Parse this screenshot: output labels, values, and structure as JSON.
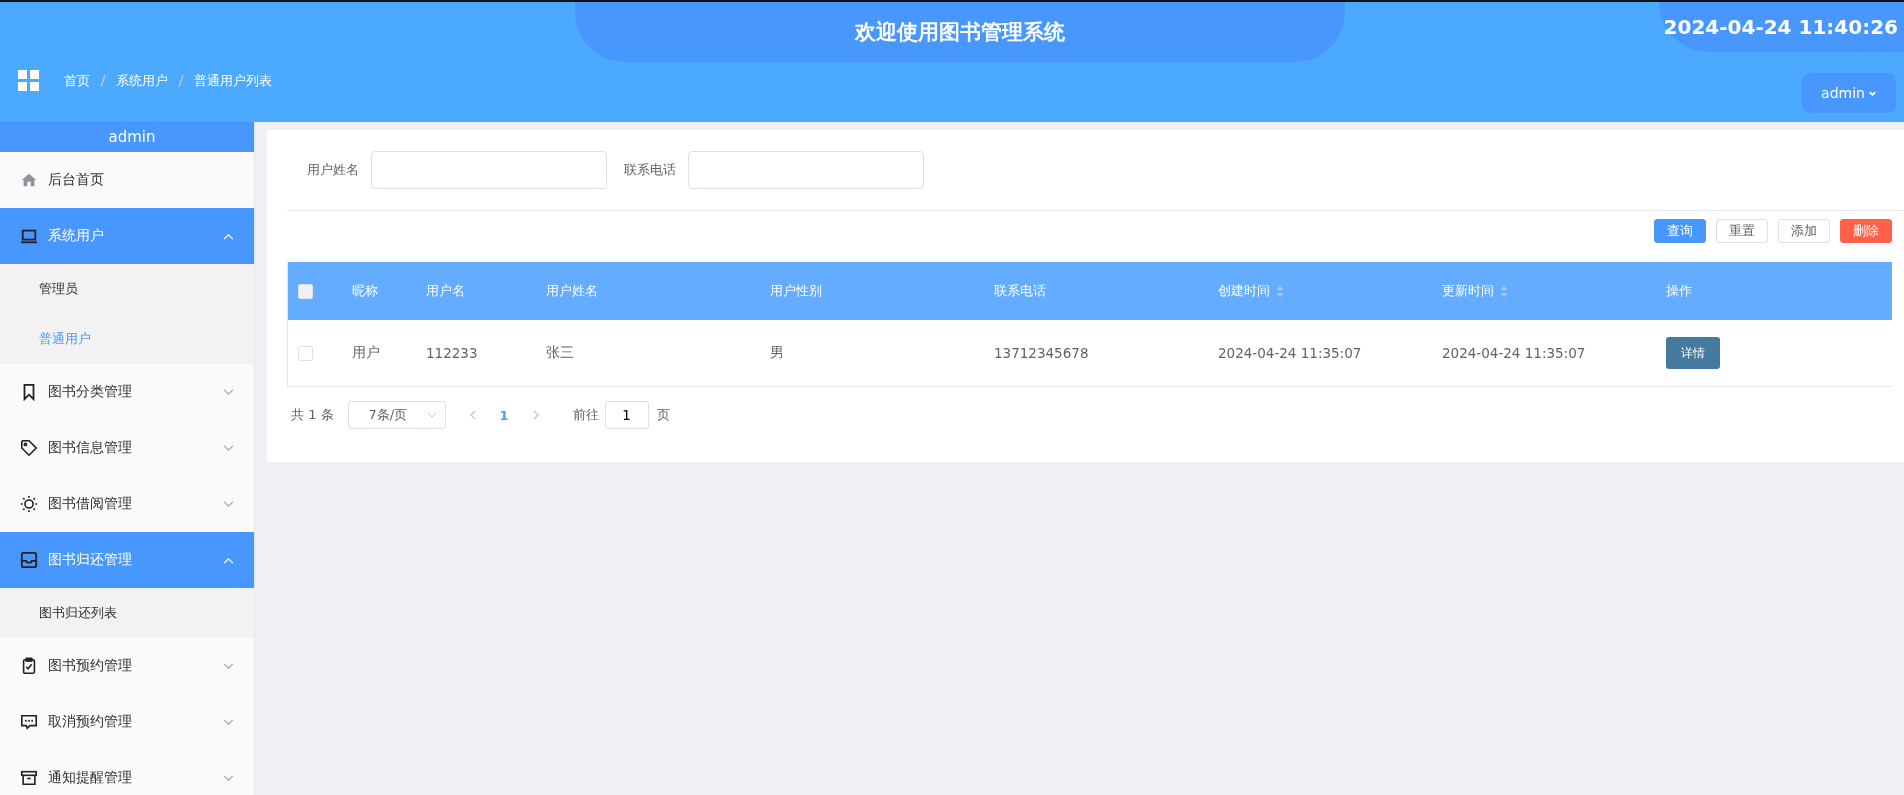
{
  "header": {
    "title": "欢迎使用图书管理系统",
    "datetime": "2024-04-24 11:40:26",
    "breadcrumb": [
      "首页",
      "系统用户",
      "普通用户列表"
    ],
    "user_menu": "admin"
  },
  "sidebar": {
    "username": "admin",
    "items": [
      {
        "label": "后台首页",
        "expanded": false,
        "has_children": false
      },
      {
        "label": "系统用户",
        "expanded": true,
        "has_children": true,
        "children": [
          {
            "label": "管理员",
            "selected": false
          },
          {
            "label": "普通用户",
            "selected": true
          }
        ]
      },
      {
        "label": "图书分类管理",
        "expanded": false,
        "has_children": true
      },
      {
        "label": "图书信息管理",
        "expanded": false,
        "has_children": true
      },
      {
        "label": "图书借阅管理",
        "expanded": false,
        "has_children": true
      },
      {
        "label": "图书归还管理",
        "expanded": true,
        "has_children": true,
        "children": [
          {
            "label": "图书归还列表",
            "selected": false
          }
        ]
      },
      {
        "label": "图书预约管理",
        "expanded": false,
        "has_children": true
      },
      {
        "label": "取消预约管理",
        "expanded": false,
        "has_children": true
      },
      {
        "label": "通知提醒管理",
        "expanded": false,
        "has_children": true
      }
    ]
  },
  "search": {
    "fields": [
      {
        "label": "用户姓名"
      },
      {
        "label": "联系电话"
      }
    ]
  },
  "actions": [
    {
      "label": "查询",
      "kind": "primary"
    },
    {
      "label": "重置",
      "kind": "plain"
    },
    {
      "label": "添加",
      "kind": "plain"
    },
    {
      "label": "删除",
      "kind": "danger"
    }
  ],
  "table": {
    "select_all": {
      "checked": false
    },
    "columns": [
      {
        "label": "昵称",
        "sortable": false
      },
      {
        "label": "用户名",
        "sortable": false
      },
      {
        "label": "用户姓名",
        "sortable": false
      },
      {
        "label": "用户性别",
        "sortable": false
      },
      {
        "label": "联系电话",
        "sortable": false
      },
      {
        "label": "创建时间",
        "sortable": true
      },
      {
        "label": "更新时间",
        "sortable": true
      },
      {
        "label": "操作",
        "sortable": false
      }
    ],
    "rows": [
      {
        "checked": false,
        "cells": [
          "用户",
          "112233",
          "张三",
          "男",
          "13712345678",
          "2024-04-24 11:35:07",
          "2024-04-24 11:35:07"
        ],
        "action": "详情"
      }
    ]
  },
  "pagination": {
    "total": "共 1 条",
    "page_size": "7条/页",
    "pages": [
      {
        "label": "1",
        "selected": true
      }
    ],
    "goto_label": "前往",
    "goto_value": "1",
    "goto_suffix": "页"
  }
}
